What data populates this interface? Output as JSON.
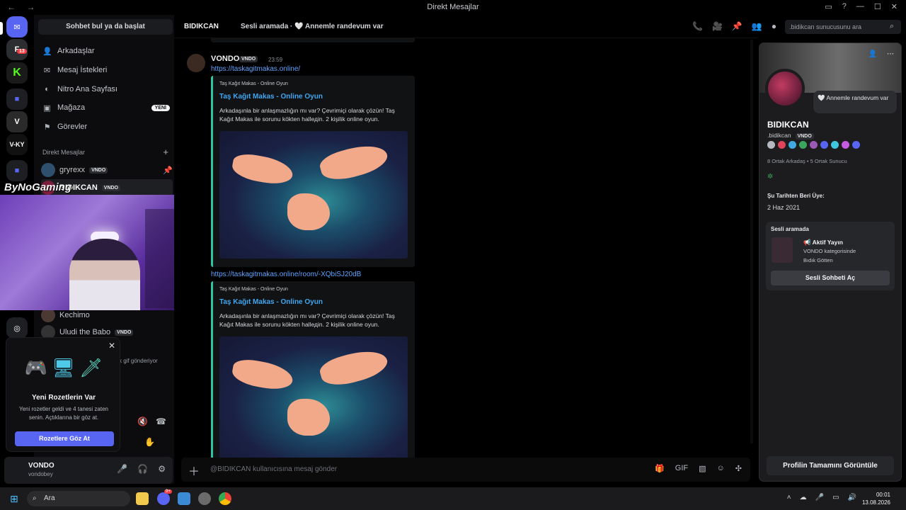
{
  "window": {
    "title": "Direkt Mesajlar",
    "back": "←",
    "forward": "→"
  },
  "rail": {
    "servers": [
      "V-KY"
    ],
    "notif_count": "13"
  },
  "sidebar": {
    "search_label": "Sohbet bul ya da başlat",
    "nav": [
      {
        "label": "Arkadaşlar",
        "icon": "friends-icon"
      },
      {
        "label": "Mesaj İstekleri",
        "icon": "mail-icon"
      },
      {
        "label": "Nitro Ana Sayfası",
        "icon": "nitro-icon"
      },
      {
        "label": "Mağaza",
        "icon": "shop-icon",
        "badge": "YENİ"
      },
      {
        "label": "Görevler",
        "icon": "quests-icon"
      }
    ],
    "dm_header": "Direkt Mesajlar",
    "dm_add": "+",
    "dms": [
      {
        "name": "gryrexx",
        "tag": "VNDO"
      },
      {
        "name": "BIDIKCAN",
        "tag": "VNDO"
      },
      {
        "name": "Kechimo",
        "tag": ""
      },
      {
        "name": "Uludi the Babo",
        "tag": "VNDO"
      }
    ],
    "partial_status": "k gif gönderiyor"
  },
  "stream_logo": "ByNoGaming",
  "popup": {
    "close": "✕",
    "title": "Yeni Rozetlerin Var",
    "desc": "Yeni rozetler geldi ve 4 tanesi zaten senin. Açtıklarına bir göz at.",
    "button": "Rozetlere Göz At"
  },
  "user": {
    "name": "VONDO",
    "handle": "vondobey"
  },
  "chat_header": {
    "name": "BIDIKCAN",
    "status": "Sesli aramada · 🤍 Annemle randevum var",
    "search_placeholder": ".bidikcan sunucusunu ara"
  },
  "message": {
    "author": "VONDO",
    "tag": "VNDO",
    "time": "23:59",
    "links": [
      "https://taskagitmakas.online/",
      "https://taskagitmakas.online/room/-XQbiSJ20dB"
    ],
    "embed": {
      "site": "Taş Kağıt Makas - Online Oyun",
      "title": "Taş Kağıt Makas - Online Oyun",
      "desc": "Arkadaşınla bir anlaşmazlığın mı var? Çevrimiçi olarak çözün! Taş Kağıt Makas ile sorunu kökten hallедin. 2 kişilik online oyun."
    }
  },
  "composer": {
    "placeholder": "@BIDIKCAN kullanıcısına mesaj gönder"
  },
  "profile": {
    "custom_status": "🤍 Annemle randevum var",
    "display_name": "BIDIKCAN",
    "username": ".bidikcan",
    "tag": "VNDO",
    "mutual": "8 Ortak Arkadaş • 5 Ortak Sunucu",
    "member_since_label": "Şu Tarihten Beri Üye:",
    "member_since": "2 Haz 2021",
    "voice": {
      "header": "Sesli aramada",
      "title": "📢 Aktif Yayın",
      "category": "VONDO kategorisinde",
      "channel": "Bıdık Götten",
      "button": "Sesli Sohbeti Aç"
    },
    "full_button": "Profilin Tamamını Görüntüle"
  },
  "taskbar": {
    "search": "Ara",
    "time": "00:01",
    "date": "13.08.2026",
    "discord_badge": "9+"
  }
}
